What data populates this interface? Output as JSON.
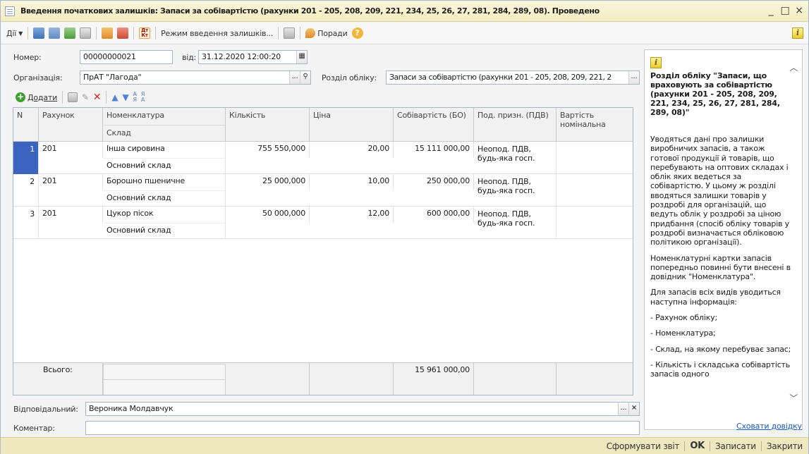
{
  "window": {
    "title": "Введення початкових залишків: Запаси за собівартістю (рахунки 201 - 205, 208, 209, 221, 234, 25, 26, 27, 281, 284, 289, 08). Проведено",
    "minimize": "_",
    "maximize": "□",
    "close": "×"
  },
  "toolbar": {
    "actions_label": "Дії",
    "mode_label": "Режим введення залишків...",
    "tips_label": "Поради"
  },
  "header": {
    "number_label": "Номер:",
    "number_value": "00000000021",
    "date_label": "від:",
    "date_value": "31.12.2020 12:00:20",
    "org_label": "Організація:",
    "org_value": "ПрАТ \"Лагода\"",
    "section_label": "Розділ обліку:",
    "section_value": "Запаси за собівартістю (рахунки 201 - 205, 208, 209, 221, 2"
  },
  "table_toolbar": {
    "add_label": "Додати"
  },
  "grid": {
    "columns": {
      "n": "N",
      "account": "Рахунок",
      "item": "Номенклатура",
      "warehouse": "Склад",
      "qty": "Кількість",
      "price": "Ціна",
      "cost": "Собівартість (БО)",
      "tax": "Под. призн. (ПДВ)",
      "nominal": "Вартість номінальна"
    },
    "rows": [
      {
        "n": "1",
        "account": "201",
        "item": "Інша сировина",
        "warehouse": "Основний склад",
        "qty": "755 550,000",
        "price": "20,00",
        "cost": "15 111 000,00",
        "tax": "Неопод. ПДВ, будь-яка госп."
      },
      {
        "n": "2",
        "account": "201",
        "item": "Борошно пшеничне",
        "warehouse": "Основний склад",
        "qty": "25 000,000",
        "price": "10,00",
        "cost": "250 000,00",
        "tax": "Неопод. ПДВ, будь-яка госп."
      },
      {
        "n": "3",
        "account": "201",
        "item": "Цукор пісок",
        "warehouse": "Основний склад",
        "qty": "50 000,000",
        "price": "12,00",
        "cost": "600 000,00",
        "tax": "Неопод. ПДВ, будь-яка госп."
      }
    ],
    "footer": {
      "total_label": "Всього:",
      "total_cost": "15 961 000,00"
    }
  },
  "bottom": {
    "responsible_label": "Відповідальний:",
    "responsible_value": "Вероника Молдавчук",
    "comment_label": "Коментар:",
    "comment_value": "",
    "hide_help": "Сховати довідку"
  },
  "help": {
    "title": "Розділ обліку \"Запаси, що враховують за собівартістю (рахунки 201 - 205, 208, 209, 221, 234, 25, 26, 27, 281, 284, 289, 08)\"",
    "p1": "Уводяться дані про залишки виробничих запасів, а також готової продукції й товарів, що перебувають на оптових складах і облік яких ведеться за собівартістю. У цьому ж розділі вводяться залишки товарів у роздробі для організацій, що ведуть облік у роздробі за ціною придбання (спосіб обліку товарів у роздробі визначається обліковою політикою організації).",
    "p2": "Номенклатурні картки запасів попередньо повинні бути внесені в довідник \"Номенклатура\".",
    "p3": "Для запасів всіх видів уводиться наступна інформація:",
    "li1": "- Рахунок обліку;",
    "li2": "- Номенклатура;",
    "li3": "- Склад, на якому перебуває запас;",
    "li4": "- Кількість і складська собівартість запасів одного"
  },
  "statusbar": {
    "report": "Сформувати звіт",
    "ok": "OK",
    "save": "Записати",
    "close": "Закрити"
  }
}
